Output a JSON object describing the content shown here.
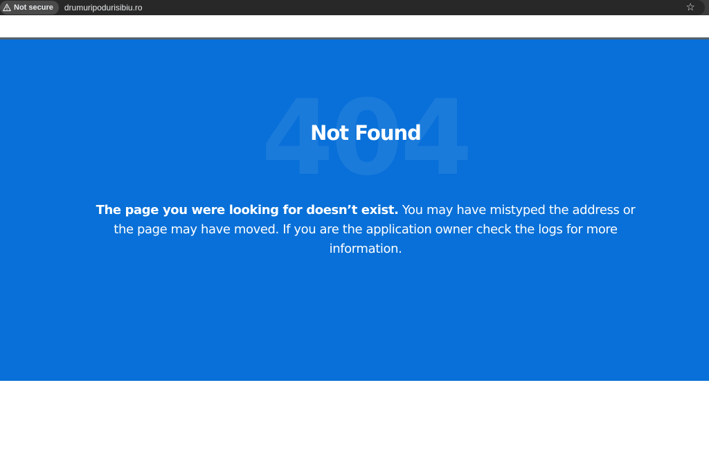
{
  "browser": {
    "security_label": "Not secure",
    "url": "drumuripodurisibiu.ro",
    "warning_icon": "warning-triangle-icon",
    "bookmark_icon": "star-outline-icon"
  },
  "page": {
    "background_code": "404",
    "title": "Not Found",
    "message_strong": "The page you were looking for doesn’t exist.",
    "message_rest": " You may have mistyped the address or the page may have moved. If you are the application owner check the logs for more information.",
    "colors": {
      "hero_background": "#0870d8",
      "text": "#ffffff"
    }
  }
}
